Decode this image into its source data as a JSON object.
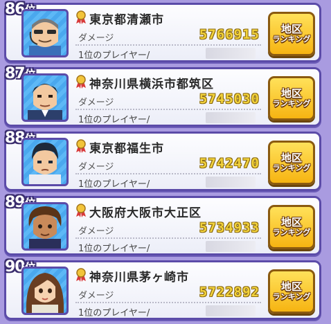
{
  "rows": [
    {
      "rank": "86",
      "rank_suffix": "位",
      "city": "東京都清瀬市",
      "damage_label": "ダメージ",
      "damage": "5766915",
      "player_label": "1位のプレイヤー/",
      "button_line1": "地区",
      "button_line2": "ランキング",
      "avatar": "man-with-sunglasses-headset"
    },
    {
      "rank": "87",
      "rank_suffix": "位",
      "city": "神奈川県横浜市都筑区",
      "damage_label": "ダメージ",
      "damage": "5745030",
      "player_label": "1位のプレイヤー/",
      "button_line1": "地区",
      "button_line2": "ランキング",
      "avatar": "man-in-suit"
    },
    {
      "rank": "88",
      "rank_suffix": "位",
      "city": "東京都福生市",
      "damage_label": "ダメージ",
      "damage": "5742470",
      "player_label": "1位のプレイヤー/",
      "button_line1": "地区",
      "button_line2": "ランキング",
      "avatar": "boy-short-hair"
    },
    {
      "rank": "89",
      "rank_suffix": "位",
      "city": "大阪府大阪市大正区",
      "damage_label": "ダメージ",
      "damage": "5734933",
      "player_label": "1位のプレイヤー/",
      "button_line1": "地区",
      "button_line2": "ランキング",
      "avatar": "boy-curly-hair"
    },
    {
      "rank": "90",
      "rank_suffix": "位",
      "city": "神奈川県茅ヶ崎市",
      "damage_label": "ダメージ",
      "damage": "5722892",
      "player_label": "1位のプレイヤー/",
      "button_line1": "地区",
      "button_line2": "ランキング",
      "avatar": "woman-brown-hair"
    }
  ],
  "colors": {
    "background": "#a99be0",
    "frame": "#5b4ba8",
    "damage": "#f2d23c",
    "button": "#f6b412"
  }
}
